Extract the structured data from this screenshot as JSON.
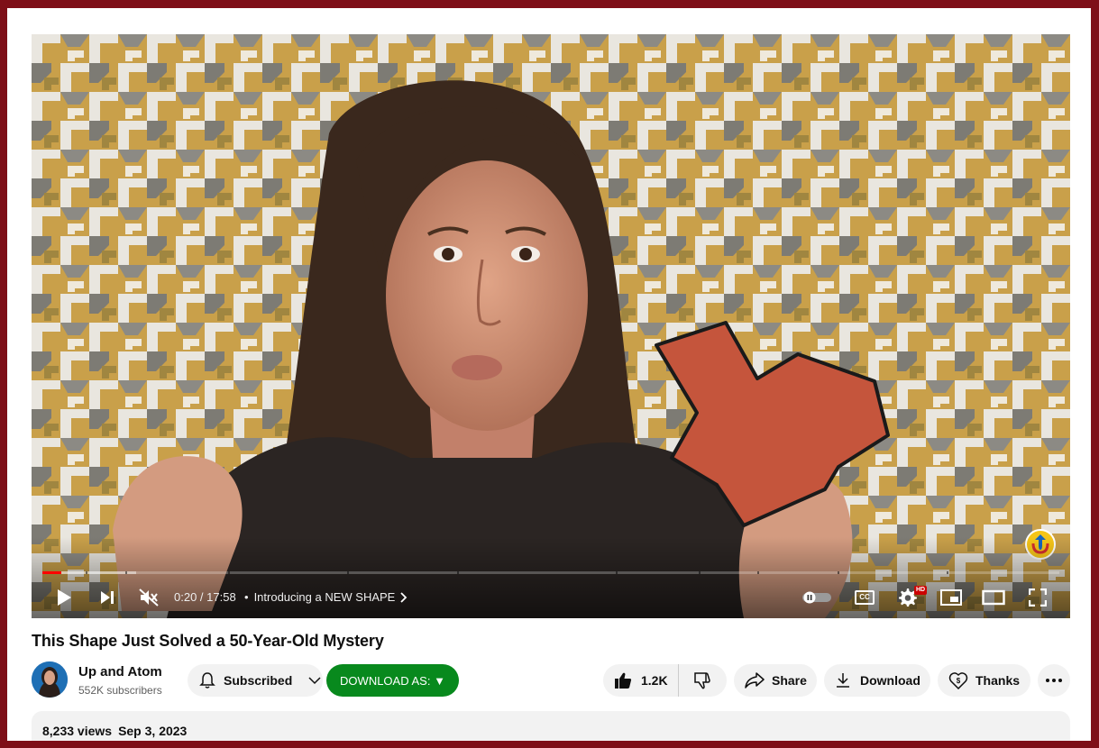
{
  "player": {
    "current_time": "0:20",
    "duration": "17:58",
    "time_separator": " / ",
    "chapter_bullet": "•",
    "chapter_title": "Introducing a NEW SHAPE",
    "progress_fraction": 0.0185,
    "buffered_fraction": 0.092,
    "hd_badge": "HD",
    "cc_label": "CC",
    "icons": [
      "play-icon",
      "next-icon",
      "volume-muted-icon",
      "chevron-right-icon",
      "autoplay-toggle-icon",
      "captions-icon",
      "settings-icon",
      "miniplayer-icon",
      "theater-icon",
      "fullscreen-icon"
    ]
  },
  "video": {
    "title": "This Shape Just Solved a 50-Year-Old Mystery"
  },
  "channel": {
    "name": "Up and Atom",
    "subscribers": "552K subscribers"
  },
  "actions": {
    "subscribed_label": "Subscribed",
    "download_as_label": "DOWNLOAD AS: ▼",
    "like_count": "1.2K",
    "share_label": "Share",
    "download_label": "Download",
    "thanks_label": "Thanks"
  },
  "description": {
    "views": "8,233 views",
    "date": "Sep 3, 2023"
  },
  "colors": {
    "frame": "#7e0f18",
    "progress": "#ff0000",
    "download_as_bg": "#08891d",
    "pill_bg": "#f2f2f2"
  }
}
